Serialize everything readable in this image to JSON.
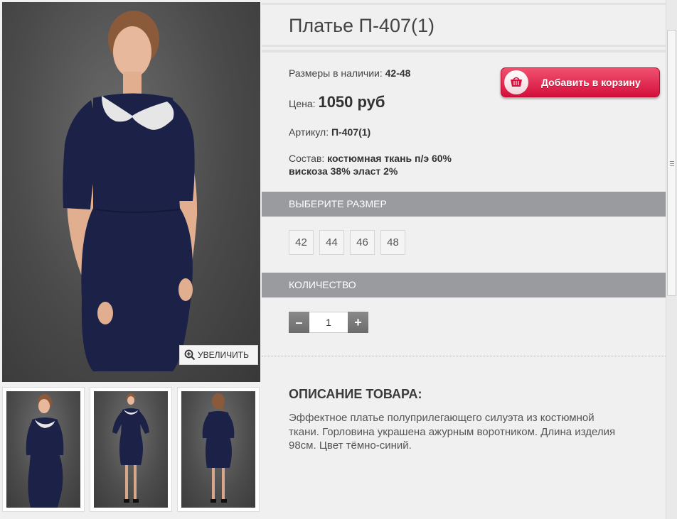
{
  "product": {
    "title": "Платье П-407(1)",
    "sizes_label": "Размеры в наличии:",
    "sizes_value": "42-48",
    "price_label": "Цена:",
    "price_value": "1050 руб",
    "sku_label": "Артикул:",
    "sku_value": "П-407(1)",
    "composition_label": "Состав:",
    "composition_value_line1": "костюмная ткань п/э 60%",
    "composition_value_line2": "вискоза 38% эласт 2%"
  },
  "cart_button": {
    "label": "Добавить в корзину",
    "icon": "basket-icon"
  },
  "size_section": {
    "heading": "ВЫБЕРИТЕ РАЗМЕР",
    "options": [
      "42",
      "44",
      "46",
      "48"
    ]
  },
  "quantity_section": {
    "heading": "КОЛИЧЕСТВО",
    "minus": "–",
    "value": "1",
    "plus": "+"
  },
  "description": {
    "title": "ОПИСАНИЕ ТОВАРА:",
    "text": "Эффектное платье полуприлегающего силуэта из костюмной\nткани. Горловина украшена ажурным воротником. Длина изделия\n 98см. Цвет тёмно-синий."
  },
  "gallery": {
    "zoom_label": "УВЕЛИЧИТЬ",
    "zoom_icon": "zoom-in-icon"
  },
  "colors": {
    "dress": "#1b2147",
    "section_header": "#999b9f",
    "cart_button": "#d4103c"
  }
}
